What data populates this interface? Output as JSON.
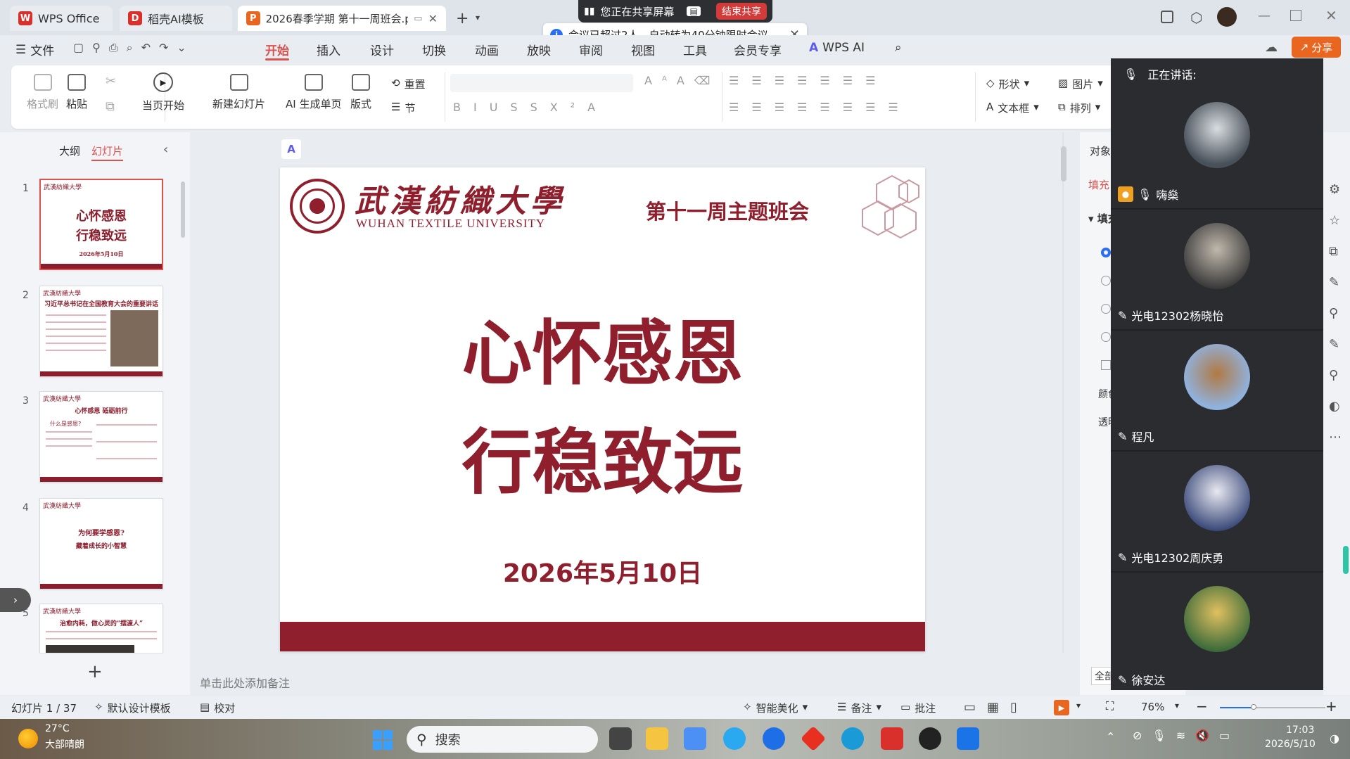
{
  "tabs": [
    {
      "label": "WPS Office",
      "logo": "W",
      "color": "#d9302b"
    },
    {
      "label": "稻壳AI模板",
      "logo": "D",
      "color": "#d9302b"
    },
    {
      "label": "2026春季学期 第十一周班会.p",
      "logo": "P",
      "color": "#e8661f"
    }
  ],
  "share_bar": {
    "text": "您正在共享屏幕",
    "end_label": "结束共享"
  },
  "notice": {
    "text": "会议已超过2人，自动转为40分钟限时会议。"
  },
  "menu": {
    "file": "文件",
    "items": [
      "开始",
      "插入",
      "设计",
      "切换",
      "动画",
      "放映",
      "审阅",
      "视图",
      "工具",
      "会员专享"
    ],
    "wps_ai": "WPS AI",
    "share": "分享"
  },
  "ribbon": {
    "format_brush": "格式刷",
    "paste": "粘贴",
    "start_from_current": "当页开始",
    "new_slide": "新建幻灯片",
    "ai_single_page": "AI 生成单页",
    "layout": "版式",
    "reset": "重置",
    "section": "节",
    "shape": "形状",
    "picture": "图片",
    "textbox": "文本框",
    "arrange": "排列"
  },
  "left_panel": {
    "tab_outline": "大纲",
    "tab_slides": "幻灯片",
    "thumbnails": [
      {
        "num": "1",
        "title": "心怀感恩\n行稳致远",
        "sub": "2026年5月10日"
      },
      {
        "num": "2",
        "title": "习近平总书记在全国教育大会的重要讲话",
        "sub": ""
      },
      {
        "num": "3",
        "title": "心怀感恩  砥砺前行",
        "sub": "什么是感恩?"
      },
      {
        "num": "4",
        "title": "为何要学感恩?",
        "sub": "藏着成长的小智慧"
      },
      {
        "num": "5",
        "title": "治愈内耗，做心灵的“摆渡人”",
        "sub": ""
      }
    ]
  },
  "slide": {
    "university_cn": "武漢紡織大學",
    "university_en": "WUHAN TEXTILE UNIVERSITY",
    "header_title": "第十一周主题班会",
    "title_line1": "心怀感恩",
    "title_line2": "行稳致远",
    "date": "2026年5月10日"
  },
  "notes_placeholder": "单击此处添加备注",
  "right_panel": {
    "tab1": "对象",
    "tab2": "填充",
    "fill_header": "填充",
    "color": "颜色",
    "transparency": "透明",
    "all": "全部"
  },
  "meeting": {
    "speaking_label": "正在讲话:",
    "participants": [
      {
        "name": "嗨燊",
        "host": true
      },
      {
        "name": "光电12302杨晓怡",
        "host": false
      },
      {
        "name": "程凡",
        "host": false
      },
      {
        "name": "光电12302周庆勇",
        "host": false
      },
      {
        "name": "徐安达",
        "host": false
      }
    ]
  },
  "statusbar": {
    "slide_info": "幻灯片 1 / 37",
    "template": "默认设计模板",
    "proofread": "校对",
    "smart_beautify": "智能美化",
    "notes": "备注",
    "comments": "批注",
    "zoom": "76%"
  },
  "taskbar": {
    "temperature": "27°C",
    "weather": "大部晴朗",
    "search_placeholder": "搜索",
    "time": "17:03",
    "date": "2026/5/10"
  },
  "colors": {
    "accent": "#d9534f",
    "maroon": "#8f1f2d",
    "meeting_bg": "#2a2c30"
  }
}
